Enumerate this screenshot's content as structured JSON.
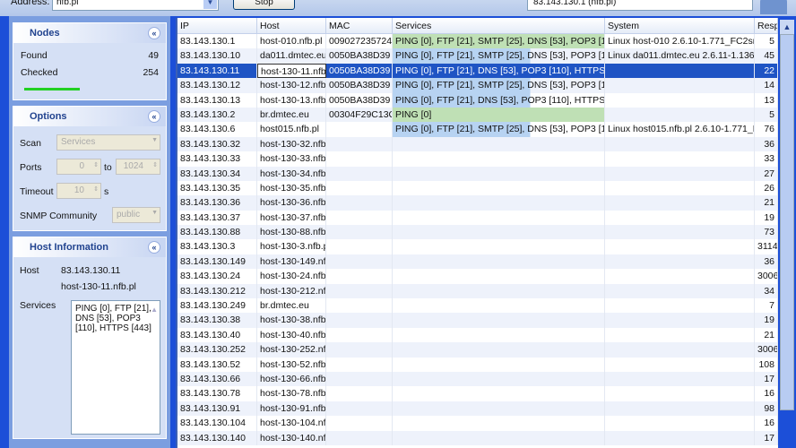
{
  "toolbar": {
    "address_label": "Address:",
    "address_value": "nfb.pl",
    "stop_label": "Stop",
    "status": "83.143.130.1 (nfb.pl)"
  },
  "nodes": {
    "title": "Nodes",
    "found_label": "Found",
    "found": "49",
    "checked_label": "Checked",
    "checked": "254",
    "progress": 1.0
  },
  "options": {
    "title": "Options",
    "scan_label": "Scan",
    "scan_value": "Services",
    "ports_label": "Ports",
    "port_from": "0",
    "to_label": "to",
    "port_to": "1024",
    "timeout_label": "Timeout",
    "timeout": "10",
    "timeout_unit": "s",
    "snmp_label": "SNMP Community",
    "snmp_value": "public"
  },
  "host_info": {
    "title": "Host Information",
    "host_label": "Host",
    "ip": "83.143.130.11",
    "hostname": "host-130-11.nfb.pl",
    "services_label": "Services",
    "services": "PING [0], FTP [21], DNS [53], POP3 [110], HTTPS [443]"
  },
  "table": {
    "columns": [
      "IP",
      "Host",
      "MAC",
      "Services",
      "System",
      "Resp"
    ],
    "rows": [
      {
        "ip": "83.143.130.1",
        "host": "host-010.nfb.pl",
        "mac": "009027235724",
        "services": "PING [0], FTP [21], SMTP [25], DNS [53], POP3 [1",
        "system": "Linux host-010 2.6.10-1.771_FC2sn",
        "resp": "5",
        "svc": "green"
      },
      {
        "ip": "83.143.130.10",
        "host": "da011.dmtec.eu",
        "mac": "0050BA38D39",
        "services": "PING [0], FTP [21], SMTP [25], DNS [53], POP3 [1",
        "system": "Linux da011.dmtec.eu 2.6.11-1.136",
        "resp": "45",
        "svc": "blue"
      },
      {
        "ip": "83.143.130.11",
        "host": "host-130-11.nfb.",
        "mac": "0050BA38D39",
        "services": "PING [0], FTP [21], DNS [53], POP3 [110], HTTPS",
        "system": "",
        "resp": "22",
        "svc": "sel"
      },
      {
        "ip": "83.143.130.12",
        "host": "host-130-12.nfb.",
        "mac": "0050BA38D39",
        "services": "PING [0], FTP [21], SMTP [25], DNS [53], POP3 [1",
        "system": "",
        "resp": "14",
        "svc": "blue"
      },
      {
        "ip": "83.143.130.13",
        "host": "host-130-13.nfb.",
        "mac": "0050BA38D39",
        "services": "PING [0], FTP [21], DNS [53], POP3 [110], HTTPS",
        "system": "",
        "resp": "13",
        "svc": "blue"
      },
      {
        "ip": "83.143.130.2",
        "host": "br.dmtec.eu",
        "mac": "00304F29C13C",
        "services": "PING [0]",
        "system": "",
        "resp": "5",
        "svc": "green"
      },
      {
        "ip": "83.143.130.6",
        "host": "host015.nfb.pl",
        "mac": "",
        "services": "PING [0], FTP [21], SMTP [25], DNS [53], POP3 [1",
        "system": "Linux host015.nfb.pl 2.6.10-1.771_F",
        "resp": "76",
        "svc": "blue"
      },
      {
        "ip": "83.143.130.32",
        "host": "host-130-32.nfb.",
        "mac": "",
        "services": "",
        "system": "",
        "resp": "36",
        "svc": ""
      },
      {
        "ip": "83.143.130.33",
        "host": "host-130-33.nfb.",
        "mac": "",
        "services": "",
        "system": "",
        "resp": "33",
        "svc": ""
      },
      {
        "ip": "83.143.130.34",
        "host": "host-130-34.nfb.",
        "mac": "",
        "services": "",
        "system": "",
        "resp": "27",
        "svc": ""
      },
      {
        "ip": "83.143.130.35",
        "host": "host-130-35.nfb.",
        "mac": "",
        "services": "",
        "system": "",
        "resp": "26",
        "svc": ""
      },
      {
        "ip": "83.143.130.36",
        "host": "host-130-36.nfb.",
        "mac": "",
        "services": "",
        "system": "",
        "resp": "21",
        "svc": ""
      },
      {
        "ip": "83.143.130.37",
        "host": "host-130-37.nfb.",
        "mac": "",
        "services": "",
        "system": "",
        "resp": "19",
        "svc": ""
      },
      {
        "ip": "83.143.130.88",
        "host": "host-130-88.nfb.",
        "mac": "",
        "services": "",
        "system": "",
        "resp": "73",
        "svc": ""
      },
      {
        "ip": "83.143.130.3",
        "host": "host-130-3.nfb.p",
        "mac": "",
        "services": "",
        "system": "",
        "resp": "3114",
        "svc": ""
      },
      {
        "ip": "83.143.130.149",
        "host": "host-130-149.nfl",
        "mac": "",
        "services": "",
        "system": "",
        "resp": "36",
        "svc": ""
      },
      {
        "ip": "83.143.130.24",
        "host": "host-130-24.nfb.",
        "mac": "",
        "services": "",
        "system": "",
        "resp": "3006",
        "svc": ""
      },
      {
        "ip": "83.143.130.212",
        "host": "host-130-212.nfl",
        "mac": "",
        "services": "",
        "system": "",
        "resp": "34",
        "svc": ""
      },
      {
        "ip": "83.143.130.249",
        "host": "br.dmtec.eu",
        "mac": "",
        "services": "",
        "system": "",
        "resp": "7",
        "svc": ""
      },
      {
        "ip": "83.143.130.38",
        "host": "host-130-38.nfb.",
        "mac": "",
        "services": "",
        "system": "",
        "resp": "19",
        "svc": ""
      },
      {
        "ip": "83.143.130.40",
        "host": "host-130-40.nfb.",
        "mac": "",
        "services": "",
        "system": "",
        "resp": "21",
        "svc": ""
      },
      {
        "ip": "83.143.130.252",
        "host": "host-130-252.nfl",
        "mac": "",
        "services": "",
        "system": "",
        "resp": "3006",
        "svc": ""
      },
      {
        "ip": "83.143.130.52",
        "host": "host-130-52.nfb.",
        "mac": "",
        "services": "",
        "system": "",
        "resp": "108",
        "svc": ""
      },
      {
        "ip": "83.143.130.66",
        "host": "host-130-66.nfb.",
        "mac": "",
        "services": "",
        "system": "",
        "resp": "17",
        "svc": ""
      },
      {
        "ip": "83.143.130.78",
        "host": "host-130-78.nfb.",
        "mac": "",
        "services": "",
        "system": "",
        "resp": "16",
        "svc": ""
      },
      {
        "ip": "83.143.130.91",
        "host": "host-130-91.nfb.",
        "mac": "",
        "services": "",
        "system": "",
        "resp": "98",
        "svc": ""
      },
      {
        "ip": "83.143.130.104",
        "host": "host-130-104.nfl",
        "mac": "",
        "services": "",
        "system": "",
        "resp": "16",
        "svc": ""
      },
      {
        "ip": "83.143.130.140",
        "host": "host-130-140.nfl",
        "mac": "",
        "services": "",
        "system": "",
        "resp": "17",
        "svc": ""
      }
    ]
  }
}
